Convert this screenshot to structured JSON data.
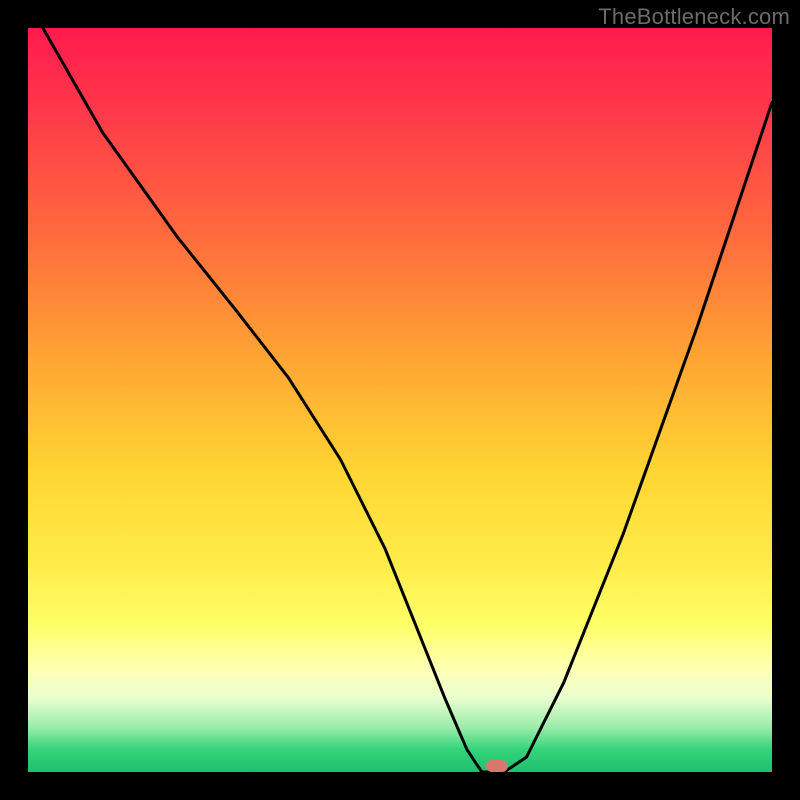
{
  "watermark": "TheBottleneck.com",
  "colors": {
    "frame": "#000000",
    "gradient_top": "#ff1a4d",
    "gradient_bottom": "#1fbf70",
    "curve": "#000000",
    "marker": "#d7786f"
  },
  "chart_data": {
    "type": "line",
    "title": "",
    "xlabel": "",
    "ylabel": "",
    "xlim": [
      0,
      100
    ],
    "ylim": [
      0,
      100
    ],
    "grid": false,
    "legend": false,
    "series": [
      {
        "name": "bottleneck-curve",
        "x": [
          2,
          10,
          20,
          28,
          35,
          42,
          48,
          52,
          56,
          59,
          61,
          64,
          67,
          72,
          80,
          90,
          100
        ],
        "values": [
          100,
          86,
          72,
          62,
          53,
          42,
          30,
          20,
          10,
          3,
          0,
          0,
          2,
          12,
          32,
          60,
          90
        ]
      }
    ],
    "annotations": [
      {
        "name": "optimal-marker",
        "x": 63,
        "y": 0
      }
    ]
  }
}
